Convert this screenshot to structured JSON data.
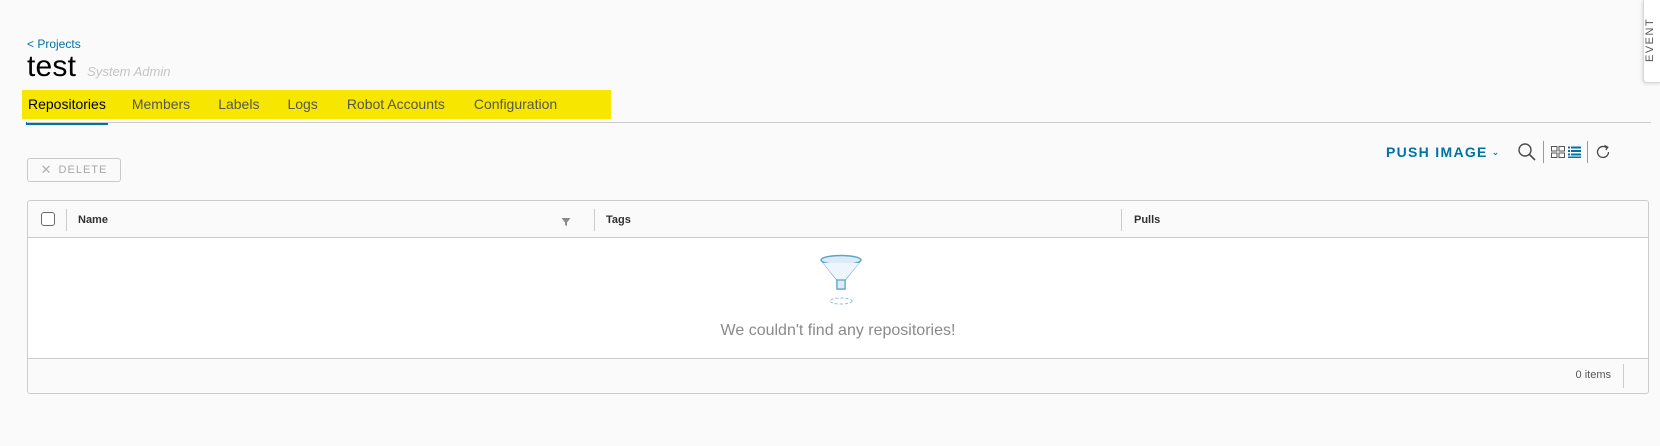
{
  "breadcrumb": {
    "back_label": "< Projects"
  },
  "project": {
    "title": "test",
    "role": "System Admin"
  },
  "tabs": [
    {
      "label": "Repositories",
      "active": true
    },
    {
      "label": "Members"
    },
    {
      "label": "Labels"
    },
    {
      "label": "Logs"
    },
    {
      "label": "Robot Accounts"
    },
    {
      "label": "Configuration"
    }
  ],
  "toolbar": {
    "delete_label": "DELETE",
    "push_image_label": "PUSH IMAGE",
    "icons": [
      "search-icon",
      "card-view-icon",
      "list-view-icon",
      "refresh-icon"
    ]
  },
  "side_panel": {
    "label": "EVENT"
  },
  "grid": {
    "columns": [
      "Name",
      "Tags",
      "Pulls"
    ],
    "empty_message": "We couldn't find any repositories!",
    "footer_count": "0 items"
  },
  "colors": {
    "accent": "#0072a3",
    "tab_highlight": "#f7e600",
    "background": "#fafafa"
  }
}
